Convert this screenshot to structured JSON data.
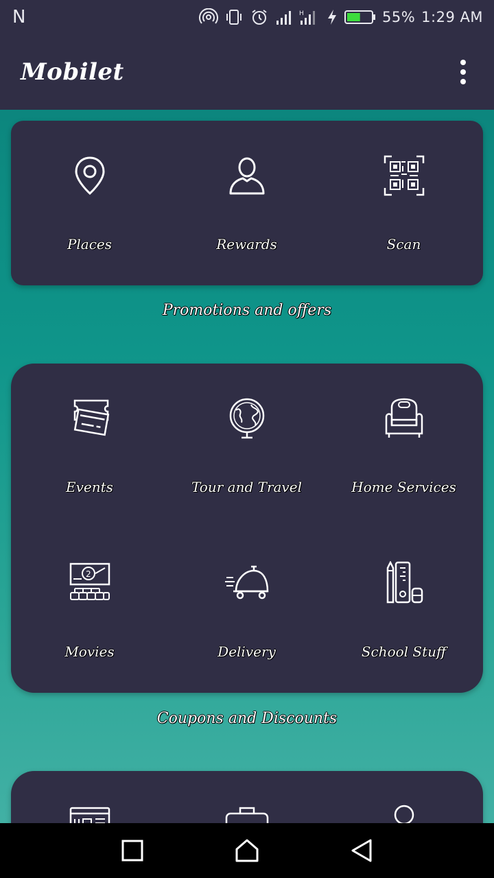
{
  "status_bar": {
    "carrier_icon": "N",
    "battery_percent": "55%",
    "time": "1:29 AM",
    "battery_level": 0.55,
    "icons": [
      "hotspot-icon",
      "vibrate-icon",
      "alarm-icon",
      "signal-icon",
      "signal-icon",
      "charging-icon",
      "battery-icon"
    ]
  },
  "app_bar": {
    "title": "Mobilet",
    "menu_icon": "more-vert-icon"
  },
  "top_card": {
    "items": [
      {
        "label": "Places",
        "icon": "location-pin-icon"
      },
      {
        "label": "Rewards",
        "icon": "person-icon"
      },
      {
        "label": "Scan",
        "icon": "qr-code-icon"
      }
    ]
  },
  "section_promotions": {
    "title": "Promotions and offers"
  },
  "promo_card": {
    "items": [
      {
        "label": "Events",
        "icon": "tickets-icon"
      },
      {
        "label": "Tour and Travel",
        "icon": "globe-icon"
      },
      {
        "label": "Home Services",
        "icon": "armchair-icon"
      },
      {
        "label": "Movies",
        "icon": "cinema-icon"
      },
      {
        "label": "Delivery",
        "icon": "delivery-icon"
      },
      {
        "label": "School Stuff",
        "icon": "stationery-icon"
      }
    ]
  },
  "section_coupons": {
    "title": "Coupons and Discounts"
  },
  "coupon_card": {
    "items": [
      {
        "icon": "newspaper-icon"
      },
      {
        "icon": "briefcase-icon"
      },
      {
        "icon": "circle-icon"
      }
    ]
  },
  "nav_bar": {
    "items": [
      "recents-icon",
      "home-icon",
      "back-icon"
    ]
  },
  "colors": {
    "bar_background": "#302e45",
    "card_background": "#302e45",
    "teal_top": "#0b7f78",
    "teal_bottom": "#48b3a8",
    "battery_green": "#3ddc3d"
  }
}
